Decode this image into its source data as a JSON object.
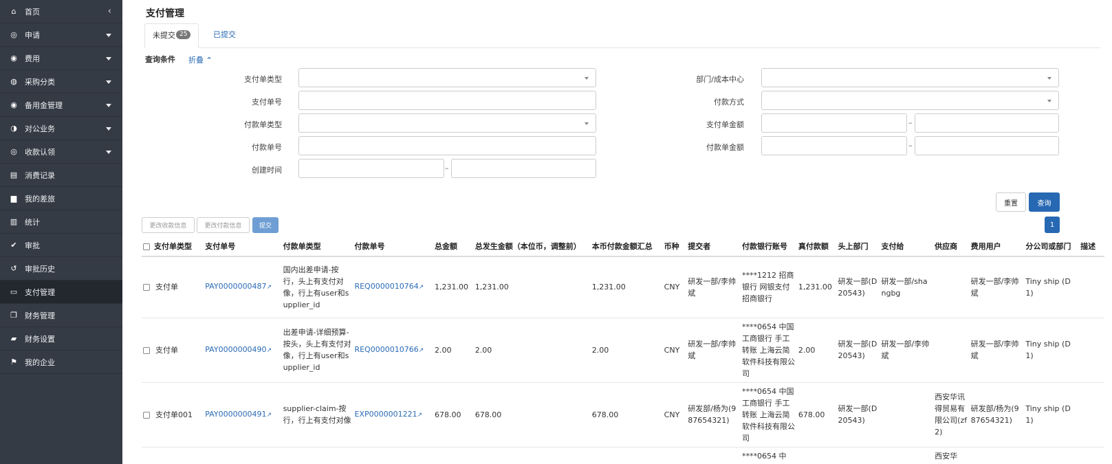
{
  "sidebar": {
    "items": [
      {
        "label": "首页",
        "icon": "home-icon",
        "glyph": "⌂",
        "chevron": "‹"
      },
      {
        "label": "申请",
        "icon": "globe-icon",
        "glyph": "◎",
        "caret": true
      },
      {
        "label": "费用",
        "icon": "coin-icon",
        "glyph": "◉",
        "caret": true
      },
      {
        "label": "采购分类",
        "icon": "cart-icon",
        "glyph": "◍",
        "caret": true
      },
      {
        "label": "备用金管理",
        "icon": "wallet-icon",
        "glyph": "◉",
        "caret": true
      },
      {
        "label": "对公业务",
        "icon": "briefcase-circle-icon",
        "glyph": "◑",
        "caret": true
      },
      {
        "label": "收款认领",
        "icon": "claim-icon",
        "glyph": "◎",
        "caret": true
      },
      {
        "label": "消费记录",
        "icon": "copy-icon",
        "glyph": "▤"
      },
      {
        "label": "我的差旅",
        "icon": "suitcase-icon",
        "glyph": "▆"
      },
      {
        "label": "统计",
        "icon": "bar-chart-icon",
        "glyph": "▥"
      },
      {
        "label": "审批",
        "icon": "check-circle-icon",
        "glyph": "✔"
      },
      {
        "label": "审批历史",
        "icon": "history-icon",
        "glyph": "↺"
      },
      {
        "label": "支付管理",
        "icon": "credit-card-icon",
        "glyph": "▭",
        "active": true
      },
      {
        "label": "财务管理",
        "icon": "clone-icon",
        "glyph": "❐"
      },
      {
        "label": "财务设置",
        "icon": "book-icon",
        "glyph": "▰"
      },
      {
        "label": "我的企业",
        "icon": "flag-icon",
        "glyph": "⚑"
      }
    ]
  },
  "page": {
    "title": "支付管理"
  },
  "tabs": [
    {
      "label": "未提交",
      "badge": "25"
    },
    {
      "label": "已提交"
    }
  ],
  "query": {
    "heading": "查询条件",
    "toggle": "折叠",
    "toggle_arrow": "⌃",
    "fields": {
      "pay_type": {
        "label": "支付单类型",
        "value": ""
      },
      "pay_no": {
        "label": "支付单号",
        "value": ""
      },
      "payment_type": {
        "label": "付款单类型",
        "value": ""
      },
      "payment_no": {
        "label": "付款单号",
        "value": ""
      },
      "created": {
        "label": "创建时间",
        "from": "",
        "to": ""
      },
      "dept": {
        "label": "部门/成本中心",
        "value": ""
      },
      "method": {
        "label": "付款方式",
        "value": ""
      },
      "pay_amount": {
        "label": "支付单金额",
        "from": "",
        "to": ""
      },
      "payment_amount": {
        "label": "付款单金额",
        "from": "",
        "to": ""
      }
    },
    "range_sep": "–"
  },
  "buttons": {
    "reset": "重置",
    "search": "查询",
    "change_receive": "更改收款信息",
    "change_payment": "更改付款信息",
    "submit": "提交",
    "page": "1"
  },
  "table": {
    "headers": [
      "支付单类型",
      "支付单号",
      "付款单类型",
      "付款单号",
      "总金额",
      "总发生金额（本位币，调整前）",
      "本币付款金额汇总",
      "币种",
      "提交者",
      "付款银行账号",
      "真付款额",
      "头上部门",
      "支付给",
      "供应商",
      "费用用户",
      "分公司或部门",
      "描述"
    ],
    "rows": [
      {
        "type": "支付单",
        "pay_no": "PAY0000000487",
        "payment_type": "国内出差申请-按行，头上有支付对像，行上有user和supplier_id",
        "payment_no": "REQ0000010764",
        "total": "1,231.00",
        "total_base": "1,231.00",
        "local_sum": "1,231.00",
        "currency": "CNY",
        "submitter": "研发一部/李帅斌",
        "bank": "****1212 招商银行 网银支付 招商银行",
        "actual": "1,231.00",
        "head_dept": "研发一部(D20543)",
        "pay_to": "研发一部/shangbg",
        "supplier": "",
        "fee_user": "研发一部/李帅斌",
        "branch": "Tiny ship (D1)",
        "desc": ""
      },
      {
        "type": "支付单",
        "pay_no": "PAY0000000490",
        "payment_type": "出差申请-详细预算-按头，头上有支付对像，行上有user和supplier_id",
        "payment_no": "REQ0000010766",
        "total": "2.00",
        "total_base": "2.00",
        "local_sum": "2.00",
        "currency": "CNY",
        "submitter": "研发一部/李帅斌",
        "bank": "****0654 中国工商银行 手工转账 上海云简软件科技有限公司",
        "actual": "2.00",
        "head_dept": "研发一部(D20543)",
        "pay_to": "研发一部/李帅斌",
        "supplier": "",
        "fee_user": "研发一部/李帅斌",
        "branch": "Tiny ship (D1)",
        "desc": ""
      },
      {
        "type": "支付单001",
        "pay_no": "PAY0000000491",
        "payment_type": "supplier-claim-按行，行上有支付对像",
        "payment_no": "EXP0000001221",
        "total": "678.00",
        "total_base": "678.00",
        "local_sum": "678.00",
        "currency": "CNY",
        "submitter": "研发部/杨为(987654321)",
        "bank": "****0654 中国工商银行 手工转账 上海云简软件科技有限公司",
        "actual": "678.00",
        "head_dept": "研发一部(D20543)",
        "pay_to": "",
        "supplier": "西安华讯得贸易有限公司(zf2)",
        "fee_user": "研发部/杨为(987654321)",
        "branch": "Tiny ship (D1)",
        "desc": ""
      },
      {
        "type": "",
        "pay_no": "",
        "payment_type": "",
        "payment_no": "",
        "total": "",
        "total_base": "",
        "local_sum": "",
        "currency": "",
        "submitter": "",
        "bank": "****0654 中",
        "actual": "",
        "head_dept": "",
        "pay_to": "",
        "supplier": "西安华",
        "fee_user": "",
        "branch": "",
        "desc": ""
      }
    ]
  },
  "icons": {
    "external_link": "↗"
  },
  "colors": {
    "sidebar_bg": "#353b45",
    "sidebar_active": "#23272e",
    "primary": "#2768b3",
    "link": "#2a6bb5",
    "badge": "#777777"
  }
}
